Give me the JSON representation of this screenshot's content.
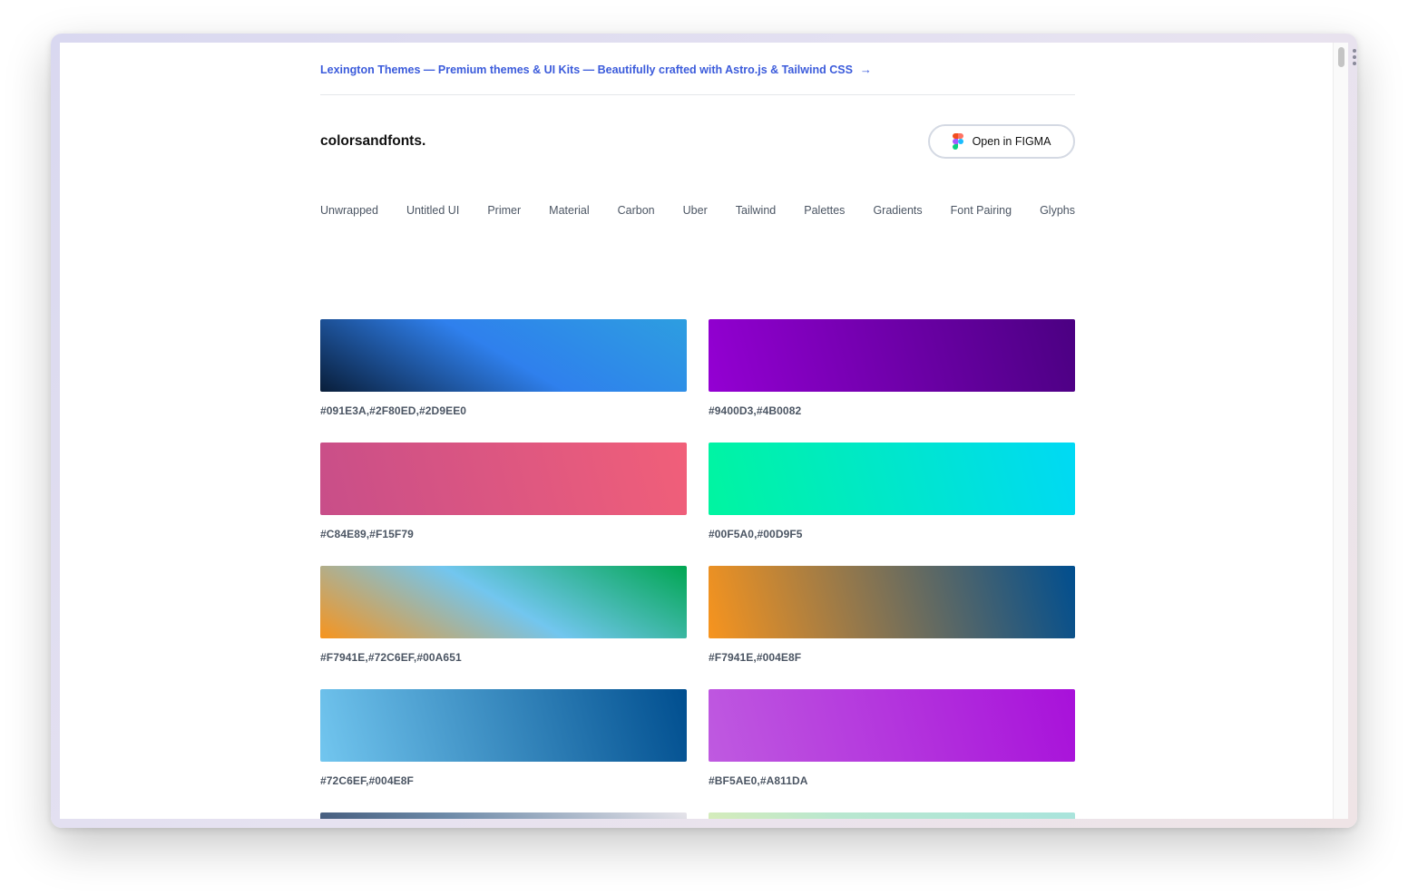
{
  "promo": {
    "text": "Lexington Themes — Premium themes & UI Kits — Beautifully crafted with Astro.js & Tailwind CSS",
    "arrow": "→"
  },
  "header": {
    "logo": "colorsandfonts.",
    "figma_button": "Open in FIGMA"
  },
  "nav": [
    "Unwrapped",
    "Untitled UI",
    "Primer",
    "Material",
    "Carbon",
    "Uber",
    "Tailwind",
    "Palettes",
    "Gradients",
    "Font Pairing",
    "Glyphs"
  ],
  "gradients": [
    {
      "label": "#091E3A,#2F80ED,#2D9EE0",
      "colors": [
        "#091E3A",
        "#2F80ED",
        "#2D9EE0"
      ]
    },
    {
      "label": "#9400D3,#4B0082",
      "colors": [
        "#9400D3",
        "#4B0082"
      ]
    },
    {
      "label": "#C84E89,#F15F79",
      "colors": [
        "#C84E89",
        "#F15F79"
      ]
    },
    {
      "label": "#00F5A0,#00D9F5",
      "colors": [
        "#00F5A0",
        "#00D9F5"
      ]
    },
    {
      "label": "#F7941E,#72C6EF,#00A651",
      "colors": [
        "#F7941E",
        "#72C6EF",
        "#00A651"
      ]
    },
    {
      "label": "#F7941E,#004E8F",
      "colors": [
        "#F7941E",
        "#004E8F"
      ]
    },
    {
      "label": "#72C6EF,#004E8F",
      "colors": [
        "#72C6EF",
        "#004E8F"
      ]
    },
    {
      "label": "#BF5AE0,#A811DA",
      "colors": [
        "#BF5AE0",
        "#A811DA"
      ]
    },
    {
      "label": "",
      "colors": [
        "#24365a",
        "#6d8aa8",
        "#e6e4ea"
      ]
    },
    {
      "label": "",
      "colors": [
        "#eef0a8",
        "#b9e7cf",
        "#a9e4dc"
      ]
    }
  ]
}
